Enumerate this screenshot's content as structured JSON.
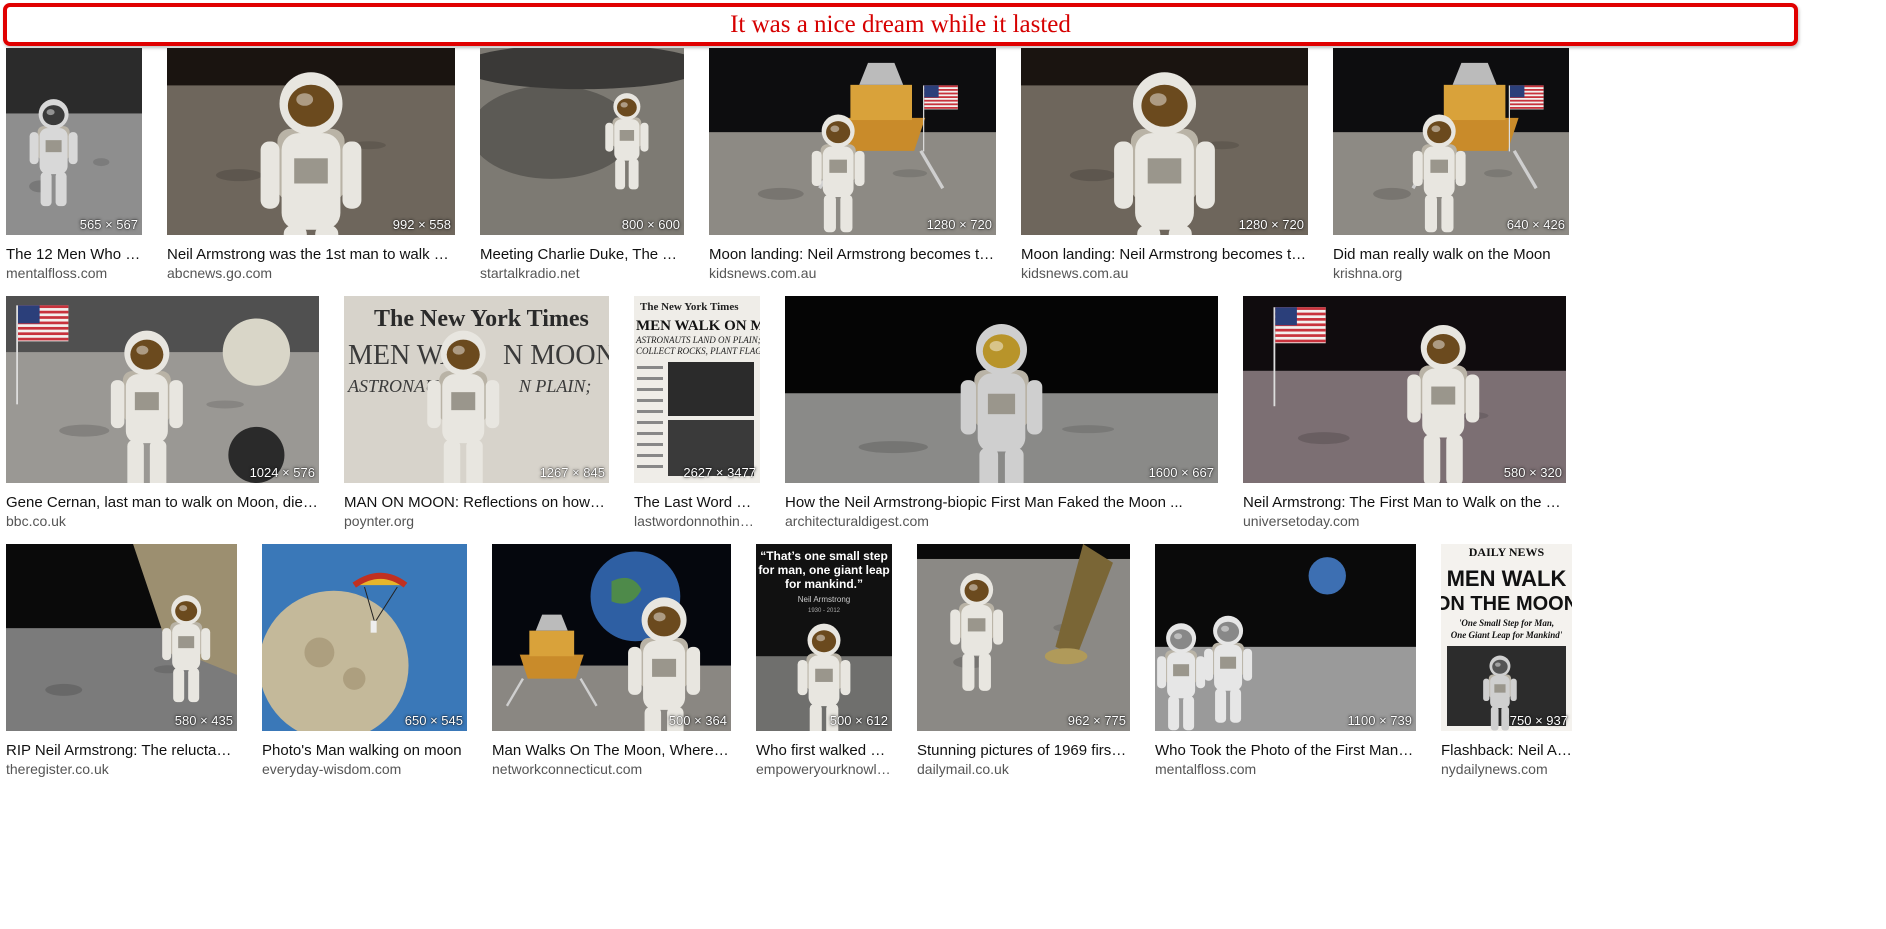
{
  "banner": {
    "text": "It was a nice dream while it lasted",
    "accent_color": "#e00000"
  },
  "results": [
    [
      {
        "caption": "The 12 Men Who Wa...",
        "source": "mentalfloss.com",
        "dims": "565 × 567",
        "scene": "bw-astronaut"
      },
      {
        "caption": "Neil Armstrong was the 1st man to walk on th...",
        "source": "abcnews.go.com",
        "dims": "992 × 558",
        "scene": "astronaut-closeup"
      },
      {
        "caption": "Meeting Charlie Duke, The You...",
        "source": "startalkradio.net",
        "dims": "800 × 600",
        "scene": "crater-astronaut"
      },
      {
        "caption": "Moon landing: Neil Armstrong becomes the fi...",
        "source": "kidsnews.com.au",
        "dims": "1280 × 720",
        "scene": "lander-flag"
      },
      {
        "caption": "Moon landing: Neil Armstrong becomes the fi...",
        "source": "kidsnews.com.au",
        "dims": "1280 × 720",
        "scene": "astronaut-closeup"
      },
      {
        "caption": "Did man really walk on the Moon",
        "source": "krishna.org",
        "dims": "640 × 426",
        "scene": "lander-flag"
      }
    ],
    [
      {
        "caption": "Gene Cernan, last man to walk on Moon, dies age...",
        "source": "bbc.co.uk",
        "dims": "1024 × 576",
        "scene": "flag-rover"
      },
      {
        "caption": "MAN ON MOON: Reflections on how man...",
        "source": "poynter.org",
        "dims": "1267 × 845",
        "scene": "newspaper-overlay"
      },
      {
        "caption": "The Last Word On ...",
        "source": "lastwordonnothing.c...",
        "dims": "2627 × 3477",
        "scene": "newspaper"
      },
      {
        "caption": "How the Neil Armstrong-biopic First Man Faked the Moon ...",
        "source": "architecturaldigest.com",
        "dims": "1600 × 667",
        "scene": "dark-astronaut"
      },
      {
        "caption": "Neil Armstrong: The First Man to Walk on the Moon",
        "source": "universetoday.com",
        "dims": "580 × 320",
        "scene": "flag-salute"
      }
    ],
    [
      {
        "caption": "RIP Neil Armstrong: The reluctant A...",
        "source": "theregister.co.uk",
        "dims": "580 × 435",
        "scene": "lander-ladder"
      },
      {
        "caption": "Photo's Man walking on moon",
        "source": "everyday-wisdom.com",
        "dims": "650 × 545",
        "scene": "parachute-moon"
      },
      {
        "caption": "Man Walks On The Moon, Where Wer...",
        "source": "networkconnecticut.com",
        "dims": "500 × 364",
        "scene": "earth-astronaut"
      },
      {
        "caption": "Who first walked on ...",
        "source": "empoweryourknowle...",
        "dims": "500 × 612",
        "scene": "quote-poster"
      },
      {
        "caption": "Stunning pictures of 1969 first m...",
        "source": "dailymail.co.uk",
        "dims": "962 × 775",
        "scene": "lander-leg"
      },
      {
        "caption": "Who Took the Photo of the First Man on t...",
        "source": "mentalfloss.com",
        "dims": "1100 × 739",
        "scene": "two-astronauts"
      },
      {
        "caption": "Flashback: Neil Arm...",
        "source": "nydailynews.com",
        "dims": "750 × 937",
        "scene": "daily-news"
      }
    ]
  ],
  "poster_text": {
    "quote_line1": "“That’s one small step",
    "quote_line2": "for man, one giant leap",
    "quote_line3": "for mankind.”",
    "quote_author": "Neil Armstrong",
    "quote_years": "1930 - 2012",
    "nyt_masthead": "The New York Times",
    "nyt_headline": "MEN WALK ON MOON",
    "nyt_sub1": "ASTRONAUTS LAND ON PLAIN;",
    "nyt_sub2": "COLLECT ROCKS, PLANT FLAG",
    "dn_masthead": "DAILY NEWS",
    "dn_headline1": "MEN WALK",
    "dn_headline2": "ON THE MOON",
    "dn_sub1": "'One Small Step for Man,",
    "dn_sub2": "One Giant Leap for Mankind'",
    "overlay_line1": "MEN WA",
    "overlay_line2": "N MOON",
    "overlay_line3": "ASTRONAU",
    "overlay_line4": "N PLAIN;"
  }
}
